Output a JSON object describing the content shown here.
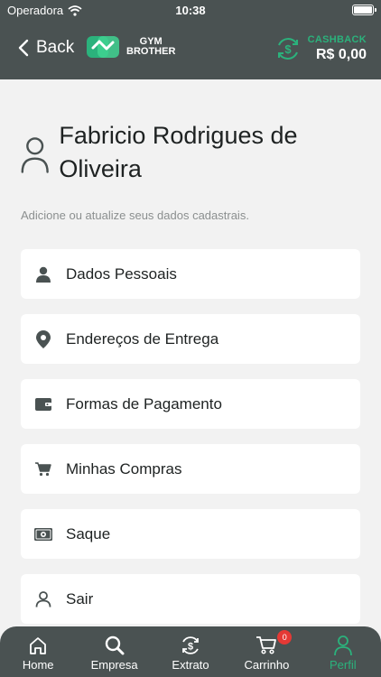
{
  "status_bar": {
    "carrier": "Operadora",
    "time": "10:38"
  },
  "header": {
    "back_label": "Back",
    "brand_line1": "GYM",
    "brand_line2": "BROTHER",
    "cashback_label": "CASHBACK",
    "cashback_value": "R$ 0,00"
  },
  "profile": {
    "name": "Fabricio Rodrigues de Oliveira",
    "hint": "Adicione ou atualize seus dados cadastrais."
  },
  "menu": {
    "items": [
      {
        "label": "Dados Pessoais",
        "icon": "person-icon"
      },
      {
        "label": "Endereços de Entrega",
        "icon": "location-pin-icon"
      },
      {
        "label": "Formas de Pagamento",
        "icon": "wallet-icon"
      },
      {
        "label": "Minhas Compras",
        "icon": "cart-icon"
      },
      {
        "label": "Saque",
        "icon": "cash-icon"
      },
      {
        "label": "Sair",
        "icon": "person-outline-icon"
      }
    ]
  },
  "tabbar": {
    "tabs": [
      {
        "label": "Home",
        "icon": "home-icon"
      },
      {
        "label": "Empresa",
        "icon": "search-icon"
      },
      {
        "label": "Extrato",
        "icon": "dollar-cycle-icon"
      },
      {
        "label": "Carrinho",
        "icon": "cart-icon"
      },
      {
        "label": "Perfil",
        "icon": "person-icon"
      }
    ],
    "cart_badge": "0",
    "active_tab": "Perfil"
  },
  "colors": {
    "bar_background": "#4a5252",
    "accent": "#2bb27c",
    "page_background": "#f2f2f2",
    "badge": "#e53935"
  }
}
